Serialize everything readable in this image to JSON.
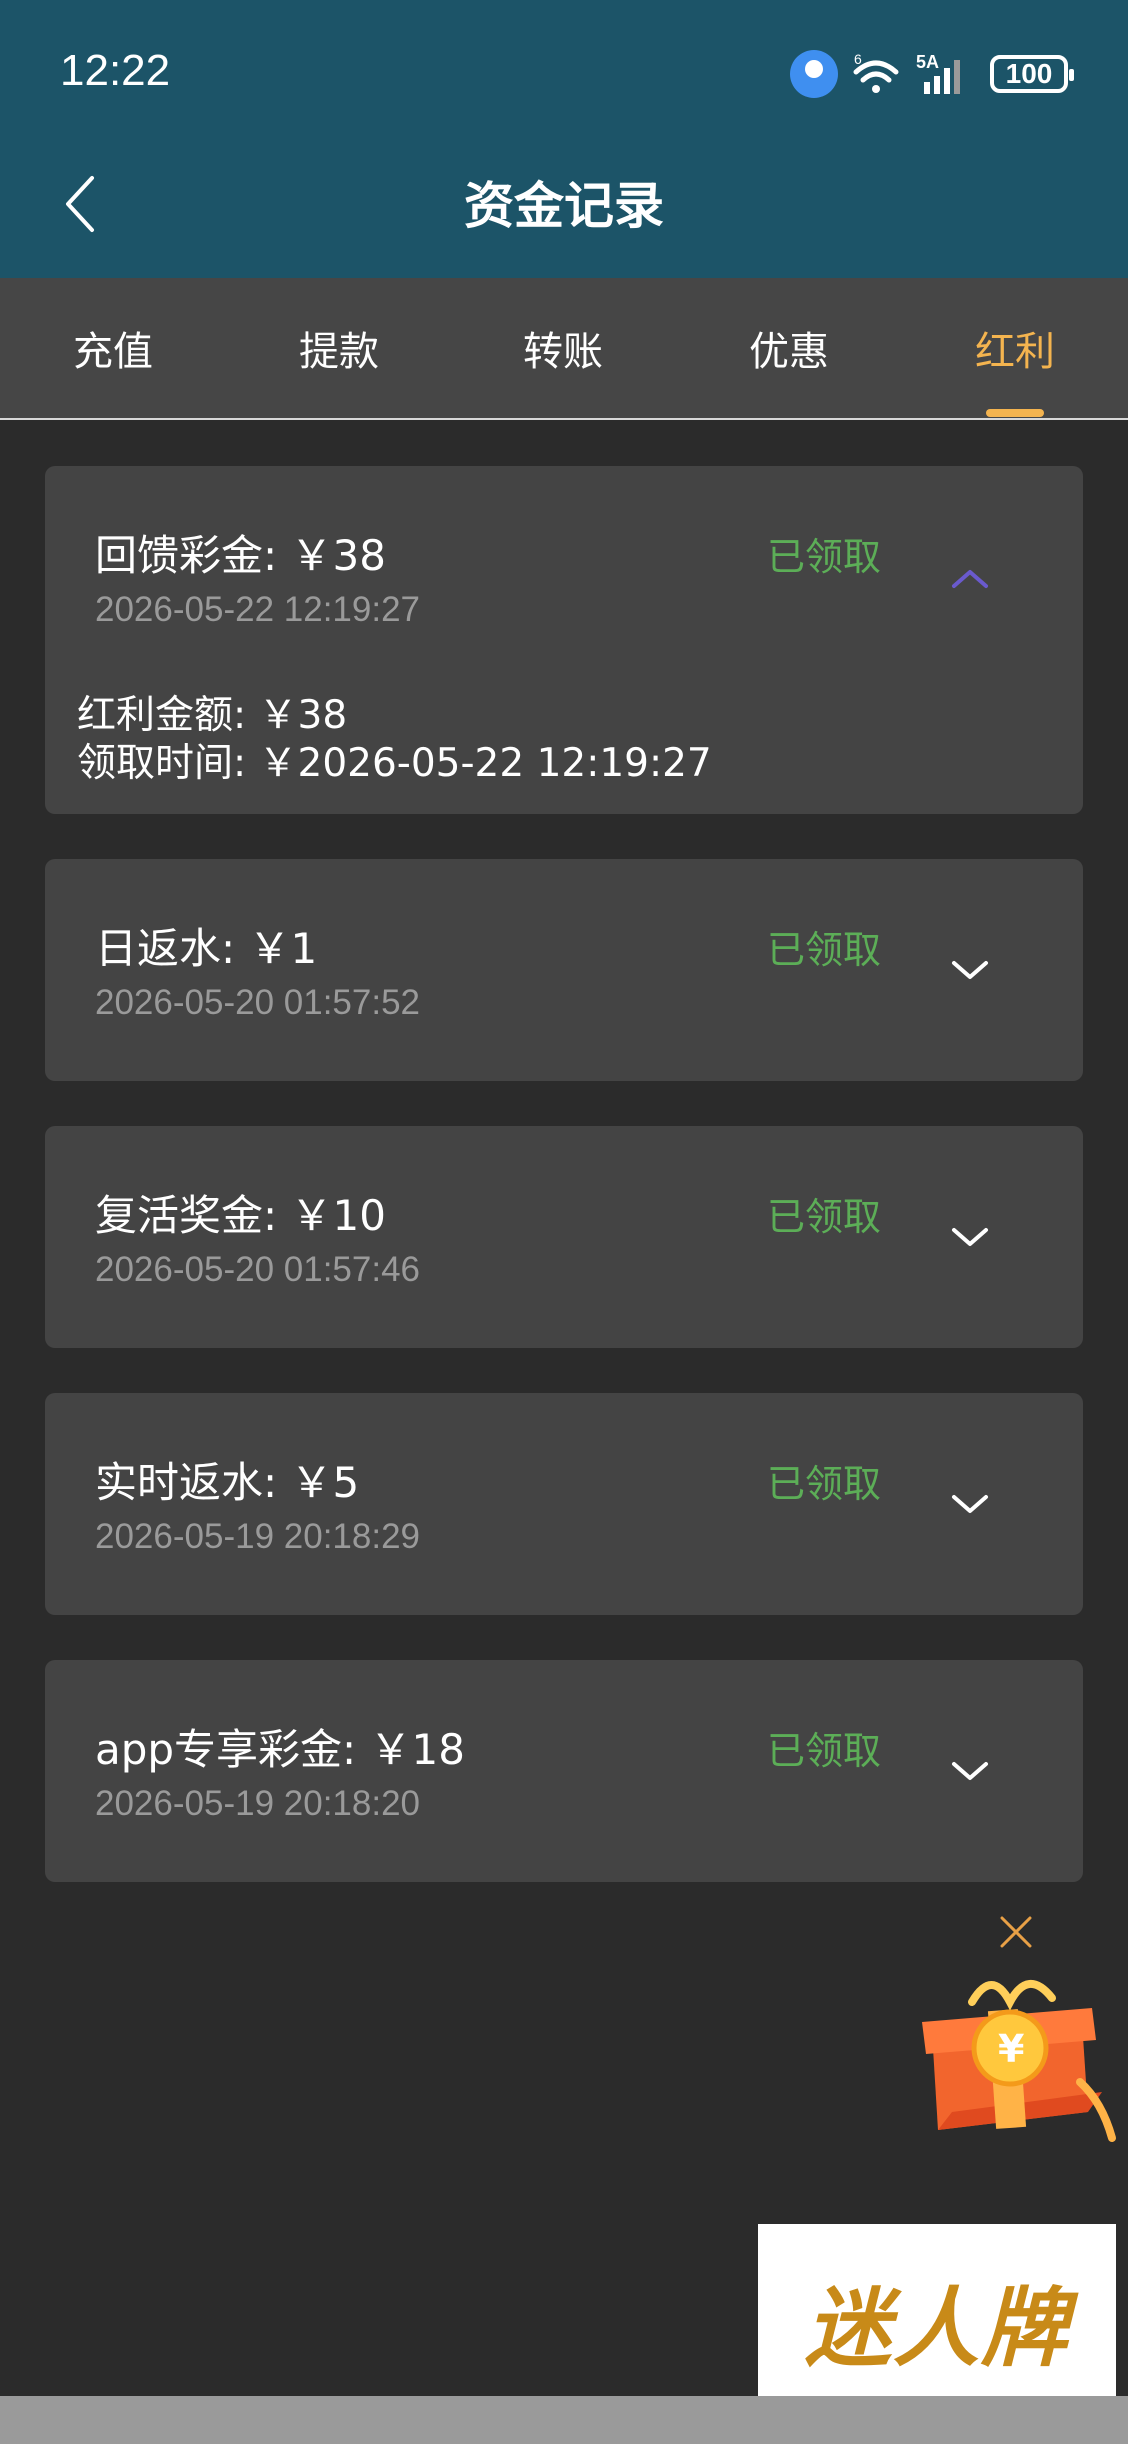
{
  "status_bar": {
    "time": "12:22",
    "network": "5A",
    "wifi_badge": "6",
    "battery": "100"
  },
  "header": {
    "title": "资金记录",
    "back_icon": "chevron-left-icon"
  },
  "tabs": [
    {
      "label": "充值",
      "active": false
    },
    {
      "label": "提款",
      "active": false
    },
    {
      "label": "转账",
      "active": false
    },
    {
      "label": "优惠",
      "active": false
    },
    {
      "label": "红利",
      "active": true
    }
  ],
  "records": [
    {
      "title": "回馈彩金: ￥38",
      "date": "2026-05-22 12:19:27",
      "status": "已领取",
      "expanded": true,
      "detail_amount": "红利金额: ￥38",
      "detail_time": "领取时间: ￥2026-05-22 12:19:27"
    },
    {
      "title": "日返水: ￥1",
      "date": "2026-05-20 01:57:52",
      "status": "已领取",
      "expanded": false
    },
    {
      "title": "复活奖金: ￥10",
      "date": "2026-05-20 01:57:46",
      "status": "已领取",
      "expanded": false
    },
    {
      "title": "实时返水: ￥5",
      "date": "2026-05-19 20:18:29",
      "status": "已领取",
      "expanded": false
    },
    {
      "title": "app专享彩金: ￥18",
      "date": "2026-05-19 20:18:20",
      "status": "已领取",
      "expanded": false
    }
  ],
  "floating": {
    "close_icon": "close-icon",
    "gift_icon": "gift-box-icon"
  },
  "brand": {
    "text": "迷人牌"
  },
  "colors": {
    "header_bg": "#1c5468",
    "page_bg": "#2b2b2b",
    "card_bg": "#444444",
    "tab_bar_bg": "#464646",
    "active_tab": "#f4b44f",
    "status_green": "#5cae57",
    "date_gray": "#9a9a9a",
    "expanded_chevron": "#6a5acd"
  }
}
